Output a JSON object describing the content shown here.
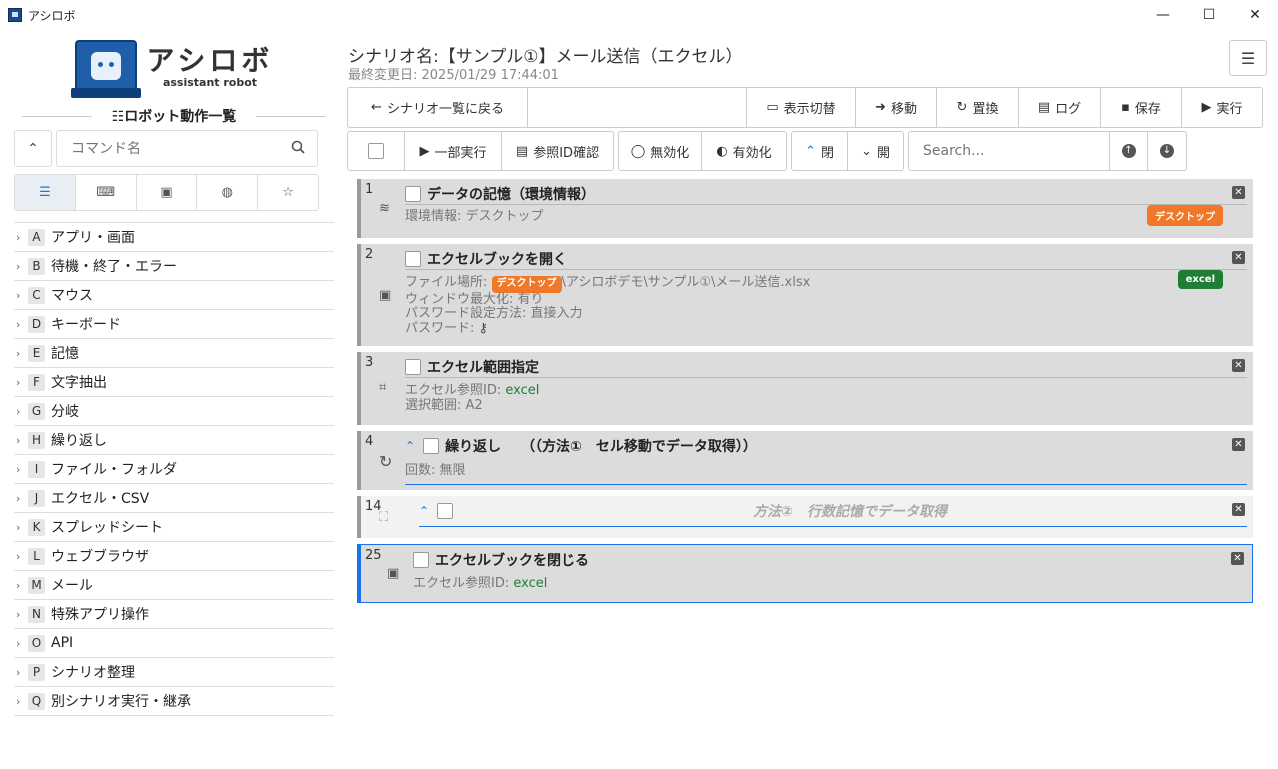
{
  "window": {
    "title": "アシロボ",
    "min": "—",
    "max": "☐",
    "close": "✕"
  },
  "logo": {
    "name": "アシロボ",
    "tagline": "assistant robot"
  },
  "sidebar": {
    "list_title": "☷ロボット動作一覧",
    "search_placeholder": "コマンド名",
    "tabs": [
      "list-icon",
      "keyboard-icon",
      "excel-icon",
      "globe-icon",
      "star-icon"
    ],
    "categories": [
      {
        "key": "A",
        "label": "アプリ・画面"
      },
      {
        "key": "B",
        "label": "待機・終了・エラー"
      },
      {
        "key": "C",
        "label": "マウス"
      },
      {
        "key": "D",
        "label": "キーボード"
      },
      {
        "key": "E",
        "label": "記憶"
      },
      {
        "key": "F",
        "label": "文字抽出"
      },
      {
        "key": "G",
        "label": "分岐"
      },
      {
        "key": "H",
        "label": "繰り返し"
      },
      {
        "key": "I",
        "label": "ファイル・フォルダ"
      },
      {
        "key": "J",
        "label": "エクセル・CSV"
      },
      {
        "key": "K",
        "label": "スプレッドシート"
      },
      {
        "key": "L",
        "label": "ウェブブラウザ"
      },
      {
        "key": "M",
        "label": "メール"
      },
      {
        "key": "N",
        "label": "特殊アプリ操作"
      },
      {
        "key": "O",
        "label": "API"
      },
      {
        "key": "P",
        "label": "シナリオ整理"
      },
      {
        "key": "Q",
        "label": "別シナリオ実行・継承"
      }
    ]
  },
  "header": {
    "title": "シナリオ名:【サンプル①】メール送信（エクセル）",
    "modified": "最終変更日: 2025/01/29 17:44:01"
  },
  "toolbar": {
    "back": "シナリオ一覧に戻る",
    "display": "表示切替",
    "move": "移動",
    "replace": "置換",
    "log": "ログ",
    "save": "保存",
    "run": "実行"
  },
  "toolbar2": {
    "partial_run": "一部実行",
    "ref_check": "参照ID確認",
    "disable": "無効化",
    "enable": "有効化",
    "close_all": "閉",
    "open_all": "開",
    "search_placeholder": "Search..."
  },
  "steps": [
    {
      "num": "1",
      "title": "データの記憶（環境情報）",
      "line1_label": "環境情報: ",
      "line1_value": "デスクトップ",
      "tag": "デスクトップ"
    },
    {
      "num": "2",
      "title": "エクセルブックを開く",
      "path_label": "ファイル場所: ",
      "path_tag": "デスクトップ",
      "path_rest": "\\アシロボデモ\\サンプル①\\メール送信.xlsx",
      "line2": "ウィンドウ最大化: 有り",
      "line3": "パスワード設定方法: 直接入力",
      "line4": "パスワード: ",
      "tag": "excel"
    },
    {
      "num": "3",
      "title": "エクセル範囲指定",
      "ref_label": "エクセル参照ID: ",
      "ref_value": "excel",
      "range": "選択範囲: A2"
    },
    {
      "num": "4",
      "title": "繰り返し",
      "comment": "（（方法①　セル移動でデータ取得））",
      "count": "回数: 無限"
    },
    {
      "num": "14",
      "comment": "方法②　行数記憶でデータ取得"
    },
    {
      "num": "25",
      "title": "エクセルブックを閉じる",
      "ref_label": "エクセル参照ID: ",
      "ref_value": "excel"
    }
  ]
}
